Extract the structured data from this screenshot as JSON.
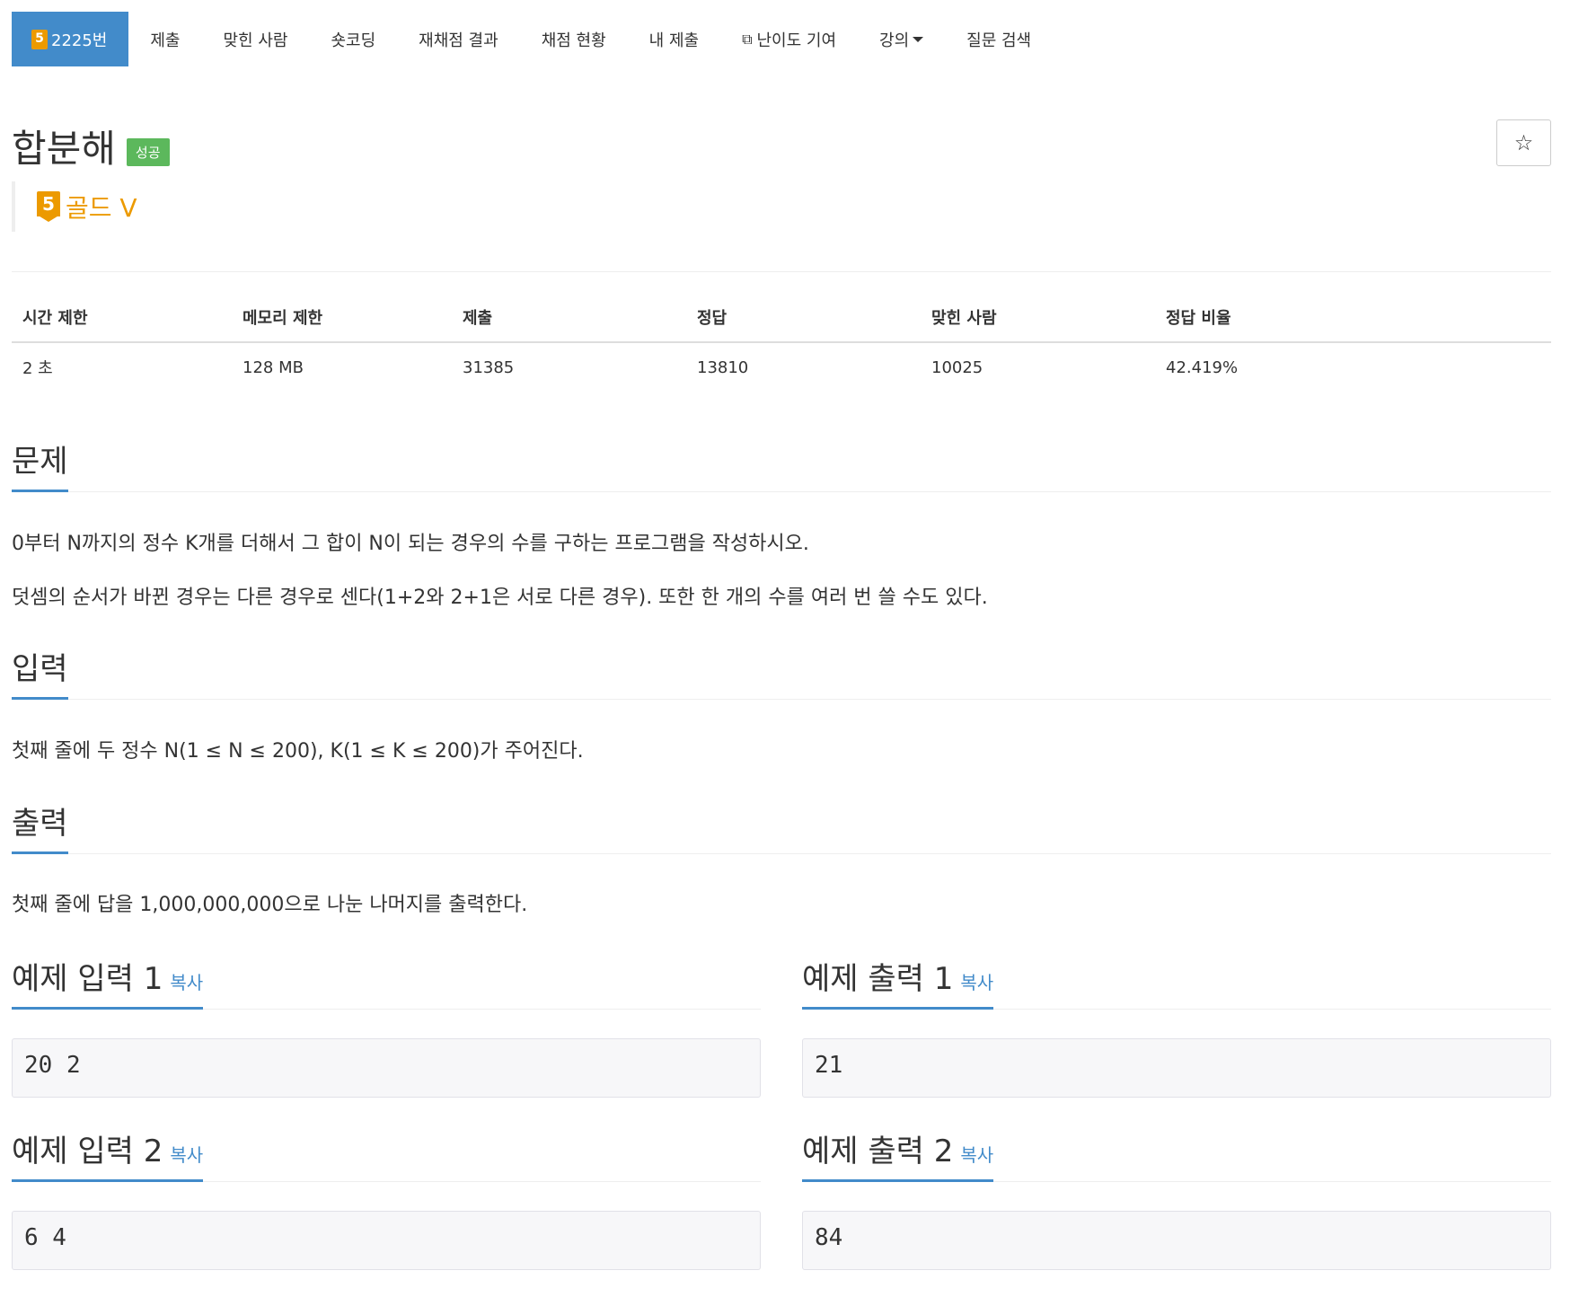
{
  "nav": {
    "problem_number": "2225번",
    "tier_badge_num": "5",
    "items": [
      "제출",
      "맞힌 사람",
      "숏코딩",
      "재채점 결과",
      "채점 현황",
      "내 제출",
      "난이도 기여",
      "강의",
      "질문 검색"
    ],
    "accent_color": "#428bca"
  },
  "problem": {
    "title": "합분해",
    "status_badge": "성공",
    "tier_num": "5",
    "tier_label": "골드 V",
    "tier_color": "#ec9a00",
    "star_icon": "☆"
  },
  "info_table": {
    "headers": [
      "시간 제한",
      "메모리 제한",
      "제출",
      "정답",
      "맞힌 사람",
      "정답 비율"
    ],
    "values": [
      "2 초",
      "128 MB",
      "31385",
      "13810",
      "10025",
      "42.419%"
    ]
  },
  "sections": {
    "problem_heading": "문제",
    "problem_p1": "0부터 N까지의 정수 K개를 더해서 그 합이 N이 되는 경우의 수를 구하는 프로그램을 작성하시오.",
    "problem_p2": "덧셈의 순서가 바뀐 경우는 다른 경우로 센다(1+2와 2+1은 서로 다른 경우). 또한 한 개의 수를 여러 번 쓸 수도 있다.",
    "input_heading": "입력",
    "input_p": "첫째 줄에 두 정수 N(1 ≤ N ≤ 200), K(1 ≤ K ≤ 200)가 주어진다.",
    "output_heading": "출력",
    "output_p": "첫째 줄에 답을 1,000,000,000으로 나눈 나머지를 출력한다."
  },
  "samples": {
    "copy_label": "복사",
    "input1_heading": "예제 입력 1",
    "output1_heading": "예제 출력 1",
    "input1": "20 2",
    "output1": "21",
    "input2_heading": "예제 입력 2",
    "output2_heading": "예제 출력 2",
    "input2": "6 4",
    "output2": "84"
  }
}
